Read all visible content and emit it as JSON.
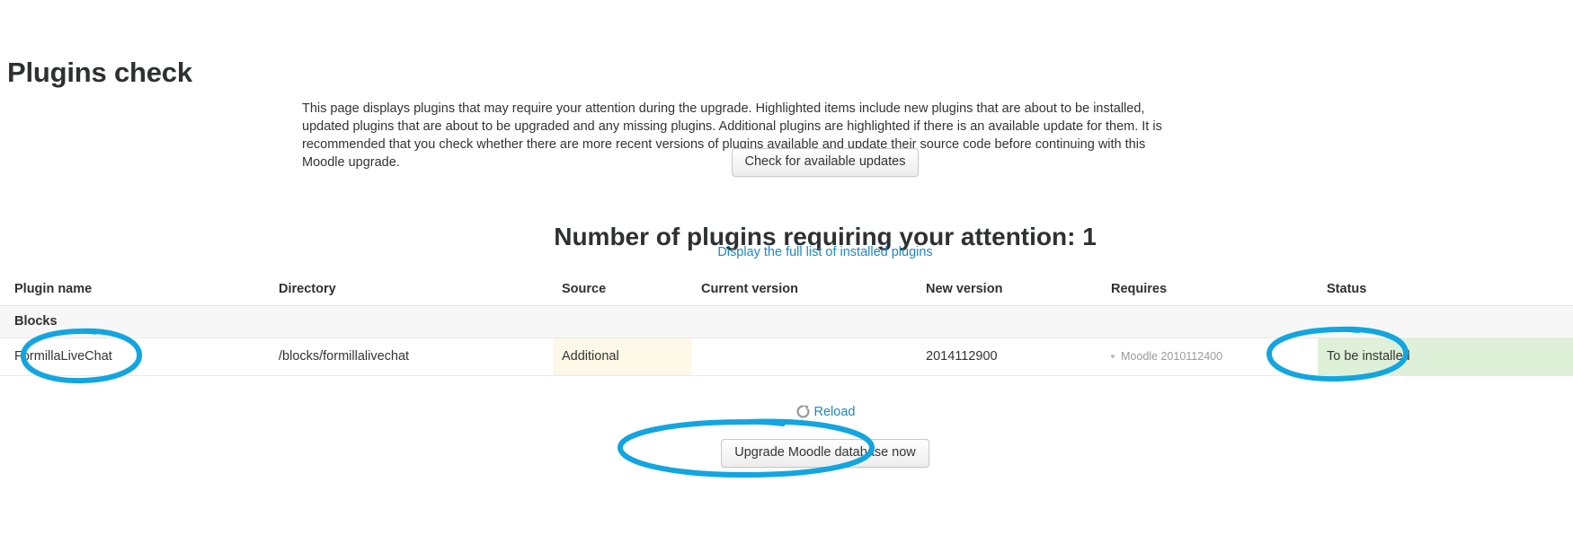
{
  "page": {
    "title": "Plugins check",
    "intro": "This page displays plugins that may require your attention during the upgrade. Highlighted items include new plugins that are about to be installed, updated plugins that are about to be upgraded and any missing plugins. Additional plugins are highlighted if there is an available update for them. It is recommended that you check whether there are more recent versions of plugins available and update their source code before continuing with this Moodle upgrade.",
    "check_updates_label": "Check for available updates",
    "attention_heading": "Number of plugins requiring your attention: 1",
    "full_list_link": "Display the full list of installed plugins",
    "reload_label": "Reload",
    "reload_icon": "refresh-icon",
    "upgrade_label": "Upgrade Moodle database now"
  },
  "table": {
    "headers": [
      "Plugin name",
      "Directory",
      "Source",
      "Current version",
      "New version",
      "Requires",
      "Status"
    ],
    "groups": [
      {
        "label": "Blocks",
        "rows": [
          {
            "plugin_name": "FormillaLiveChat",
            "directory": "/blocks/formillalivechat",
            "source": "Additional",
            "current_version": "",
            "new_version": "2014112900",
            "requires": "Moodle 2010112400",
            "status": "To be installed"
          }
        ]
      }
    ]
  },
  "colors": {
    "link": "#1e87c6",
    "source_highlight": "#fdf8e7",
    "status_highlight": "#dff0d8",
    "annotation": "#12a5e0"
  }
}
